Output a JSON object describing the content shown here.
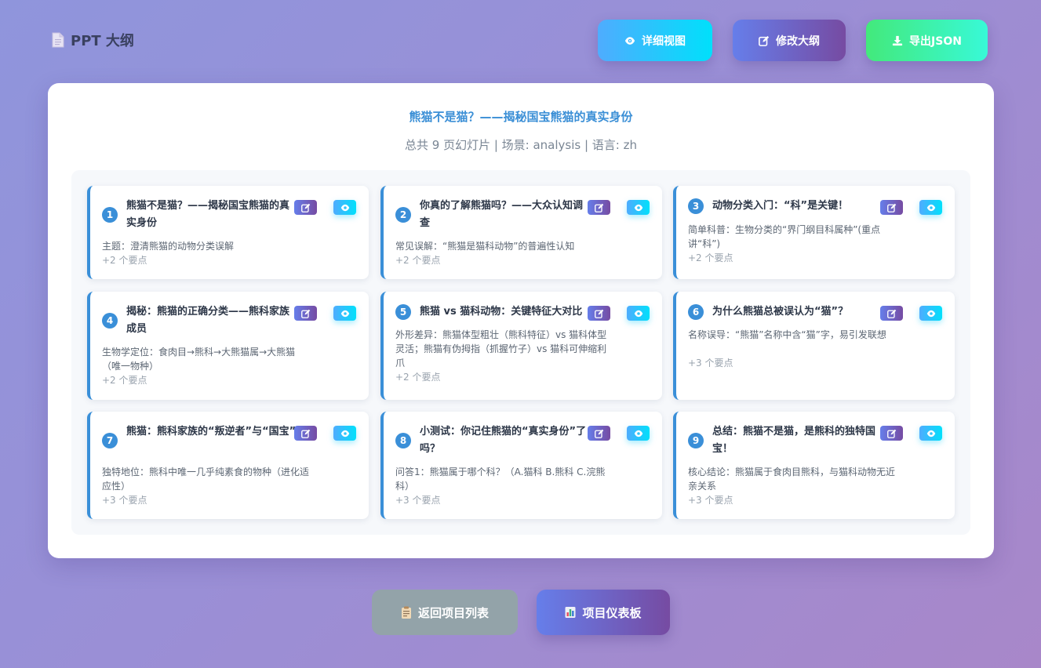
{
  "header": {
    "title": "PPT 大纲",
    "buttons": {
      "detail": "详细视图",
      "edit": "修改大纲",
      "export": "导出JSON"
    }
  },
  "outline": {
    "title": "熊猫不是猫？——揭秘国宝熊猫的真实身份",
    "meta": "总共 9 页幻灯片 | 场景: analysis | 语言: zh"
  },
  "slides": [
    {
      "num": "1",
      "title": "熊猫不是猫？——揭秘国宝熊猫的真实身份",
      "desc": "主题：澄清熊猫的动物分类误解",
      "more": "+2 个要点"
    },
    {
      "num": "2",
      "title": "你真的了解熊猫吗？——大众认知调查",
      "desc": "常见误解：“熊猫是猫科动物”的普遍性认知",
      "more": "+2 个要点"
    },
    {
      "num": "3",
      "title": "动物分类入门：“科”是关键！",
      "desc": "简单科普：生物分类的“界门纲目科属种”(重点讲“科”)",
      "more": "+2 个要点"
    },
    {
      "num": "4",
      "title": "揭秘：熊猫的正确分类——熊科家族成员",
      "desc": "生物学定位：食肉目→熊科→大熊猫属→大熊猫（唯一物种）",
      "more": "+2 个要点"
    },
    {
      "num": "5",
      "title": "熊猫 vs 猫科动物：关键特征大对比",
      "desc": "外形差异：熊猫体型粗壮（熊科特征）vs 猫科体型灵活；熊猫有伪拇指（抓握竹子）vs 猫科可伸缩利爪",
      "more": "+2 个要点"
    },
    {
      "num": "6",
      "title": "为什么熊猫总被误认为“猫”？",
      "desc": "名称误导：“熊猫”名称中含“猫”字，易引发联想",
      "more": "+3 个要点"
    },
    {
      "num": "7",
      "title": "熊猫：熊科家族的“叛逆者”与“国宝”",
      "desc": "独特地位：熊科中唯一几乎纯素食的物种（进化适应性）",
      "more": "+3 个要点"
    },
    {
      "num": "8",
      "title": "小测试：你记住熊猫的“真实身份”了吗？",
      "desc": "问答1：熊猫属于哪个科？（A.猫科 B.熊科 C.浣熊科）",
      "more": "+3 个要点"
    },
    {
      "num": "9",
      "title": "总结：熊猫不是猫，是熊科的独特国宝！",
      "desc": "核心结论：熊猫属于食肉目熊科，与猫科动物无近亲关系",
      "more": "+3 个要点"
    }
  ],
  "footer": {
    "back": "返回项目列表",
    "dashboard": "项目仪表板"
  },
  "colors": {
    "accent": "#3a8fd8",
    "edit_gradient": [
      "#667eea",
      "#764ba2"
    ],
    "view_gradient": [
      "#4facfe",
      "#00e0fb"
    ],
    "export_gradient": [
      "#43e97b",
      "#38f9d7"
    ]
  },
  "icons": {
    "title": "document-icon",
    "detail": "eye-icon",
    "edit": "edit-icon",
    "export": "download-icon",
    "back": "clipboard-icon",
    "dashboard": "bar-chart-icon"
  }
}
